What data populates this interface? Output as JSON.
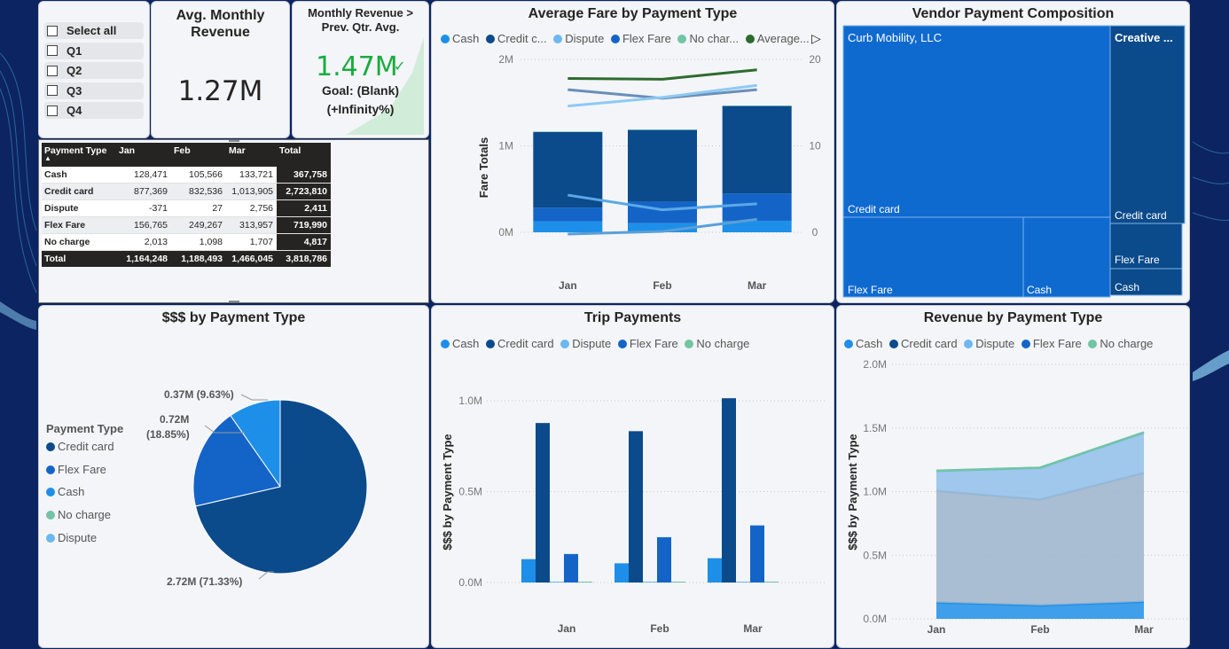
{
  "theme": {
    "background": "#0c2461",
    "credit_card": "#0b4a8b",
    "flex_fare": "#1464c8",
    "cash": "#1e8fe8",
    "dispute": "#6cb8f0",
    "no_charge": "#72c4a4",
    "average": "#2e6b2e",
    "kpi_green": "#1aab40"
  },
  "slicer": {
    "items": [
      "Select all",
      "Q1",
      "Q2",
      "Q3",
      "Q4"
    ]
  },
  "kpi_avg": {
    "title_line1": "Avg. Monthly",
    "title_line2": "Revenue",
    "value": "1.27M"
  },
  "kpi_goal": {
    "title_line1": "Monthly Revenue >",
    "title_line2": "Prev. Qtr. Avg.",
    "value": "1.47M",
    "check_icon": "check-icon",
    "goal_line1": "Goal: (Blank)",
    "goal_line2": "(+Infinity%)"
  },
  "matrix": {
    "headers": [
      "Payment Type",
      "Jan",
      "Feb",
      "Mar",
      "Total"
    ],
    "rows": [
      [
        "Cash",
        "128,471",
        "105,566",
        "133,721",
        "367,758"
      ],
      [
        "Credit card",
        "877,369",
        "832,536",
        "1,013,905",
        "2,723,810"
      ],
      [
        "Dispute",
        "-371",
        "27",
        "2,756",
        "2,411"
      ],
      [
        "Flex Fare",
        "156,765",
        "249,267",
        "313,957",
        "719,990"
      ],
      [
        "No charge",
        "2,013",
        "1,098",
        "1,707",
        "4,817"
      ]
    ],
    "total": [
      "Total",
      "1,164,248",
      "1,188,493",
      "1,466,045",
      "3,818,786"
    ]
  },
  "avg_fare": {
    "title": "Average Fare by Payment Type",
    "legend": [
      "Cash",
      "Credit c...",
      "Dispute",
      "Flex Fare",
      "No char...",
      "Average..."
    ],
    "legend_next_icon": "play-triangle-icon"
  },
  "vendor": {
    "title": "Vendor Payment Composition",
    "labels": {
      "curb": "Curb Mobility, LLC",
      "creative": "Creative ...",
      "curb_credit": "Credit card",
      "curb_flex": "Flex Fare",
      "curb_cash": "Cash",
      "cr_credit": "Credit card",
      "cr_flex": "Flex Fare",
      "cr_cash": "Cash"
    }
  },
  "pie": {
    "title": "$$$ by Payment Type",
    "legend_title": "Payment Type",
    "legend": [
      "Credit card",
      "Flex Fare",
      "Cash",
      "No charge",
      "Dispute"
    ],
    "label_credit": "2.72M (71.33%)",
    "label_flex_1": "0.72M",
    "label_flex_2": "(18.85%)",
    "label_cash": "0.37M (9.63%)"
  },
  "trip": {
    "title": "Trip Payments",
    "legend": [
      "Cash",
      "Credit card",
      "Dispute",
      "Flex Fare",
      "No charge"
    ]
  },
  "revenue": {
    "title": "Revenue by Payment Type",
    "legend": [
      "Cash",
      "Credit card",
      "Dispute",
      "Flex Fare",
      "No charge"
    ]
  },
  "chart_data": [
    {
      "type": "bar",
      "id": "avg_fare",
      "title": "Average Fare by Payment Type",
      "categories": [
        "Jan",
        "Feb",
        "Mar"
      ],
      "ylabel": "Fare Totals",
      "ylim": [
        0,
        2000000
      ],
      "y2lim": [
        0,
        20
      ],
      "y_ticks": [
        "0M",
        "1M",
        "2M"
      ],
      "y2_ticks": [
        "0",
        "10",
        "20"
      ],
      "stacked": true,
      "series": [
        {
          "name": "Cash",
          "values": [
            128471,
            105566,
            133721
          ],
          "color": "#1e8fe8"
        },
        {
          "name": "Credit card",
          "values": [
            877369,
            832536,
            1013905
          ],
          "color": "#0b4a8b"
        },
        {
          "name": "Dispute",
          "values": [
            -371,
            27,
            2756
          ],
          "color": "#6cb8f0"
        },
        {
          "name": "Flex Fare",
          "values": [
            156765,
            249267,
            313957
          ],
          "color": "#1464c8"
        },
        {
          "name": "No charge",
          "values": [
            2013,
            1098,
            1707
          ],
          "color": "#72c4a4"
        }
      ],
      "lines_secondary_axis": [
        {
          "name": "Average",
          "values": [
            17.8,
            17.7,
            18.8
          ],
          "color": "#2e6b2e"
        },
        {
          "name": "Credit card",
          "values": [
            16.5,
            15.5,
            16.5
          ],
          "color": "#6a8fb8"
        },
        {
          "name": "Dispute",
          "values": [
            14.6,
            15.6,
            17.0
          ],
          "color": "#8ec9f3"
        },
        {
          "name": "Cash",
          "values": [
            4.3,
            2.6,
            3.3
          ],
          "color": "#5aa8e6"
        },
        {
          "name": "Flex Fare",
          "values": [
            -0.2,
            0.1,
            1.5
          ],
          "color": "#5a9fd8"
        }
      ]
    },
    {
      "type": "pie",
      "id": "pie",
      "title": "$$$ by Payment Type",
      "slices": [
        {
          "name": "Credit card",
          "value": 2.72,
          "percent": 71.33,
          "color": "#0b4a8b"
        },
        {
          "name": "Flex Fare",
          "value": 0.72,
          "percent": 18.85,
          "color": "#1464c8"
        },
        {
          "name": "Cash",
          "value": 0.37,
          "percent": 9.63,
          "color": "#1e8fe8"
        }
      ]
    },
    {
      "type": "bar",
      "id": "trip",
      "title": "Trip Payments",
      "categories": [
        "Jan",
        "Feb",
        "Mar"
      ],
      "ylabel": "$$$ by Payment Type",
      "ylim": [
        0,
        1000000
      ],
      "y_ticks": [
        "0.0M",
        "0.5M",
        "1.0M"
      ],
      "series": [
        {
          "name": "Cash",
          "values": [
            128471,
            105566,
            133721
          ],
          "color": "#1e8fe8"
        },
        {
          "name": "Credit card",
          "values": [
            877369,
            832536,
            1013905
          ],
          "color": "#0b4a8b"
        },
        {
          "name": "Dispute",
          "values": [
            -371,
            27,
            2756
          ],
          "color": "#6cb8f0"
        },
        {
          "name": "Flex Fare",
          "values": [
            156765,
            249267,
            313957
          ],
          "color": "#1464c8"
        },
        {
          "name": "No charge",
          "values": [
            2013,
            1098,
            1707
          ],
          "color": "#72c4a4"
        }
      ]
    },
    {
      "type": "area",
      "id": "revenue",
      "title": "Revenue by Payment Type",
      "categories": [
        "Jan",
        "Feb",
        "Mar"
      ],
      "ylabel": "$$$ by Payment Type",
      "ylim": [
        0,
        2000000
      ],
      "y_ticks": [
        "0.0M",
        "0.5M",
        "1.0M",
        "1.5M",
        "2.0M"
      ],
      "stacked": true,
      "series": [
        {
          "name": "Cash",
          "values": [
            128471,
            105566,
            133721
          ],
          "color": "#1e8fe8"
        },
        {
          "name": "Credit card",
          "values": [
            877369,
            832536,
            1013905
          ],
          "color": "#9bb4cc"
        },
        {
          "name": "Dispute",
          "values": [
            -371,
            27,
            2756
          ],
          "color": "#6cb8f0"
        },
        {
          "name": "Flex Fare",
          "values": [
            156765,
            249267,
            313957
          ],
          "color": "#8fc0ea"
        },
        {
          "name": "No charge",
          "values": [
            2013,
            1098,
            1707
          ],
          "color": "#72c4a4"
        }
      ]
    }
  ]
}
